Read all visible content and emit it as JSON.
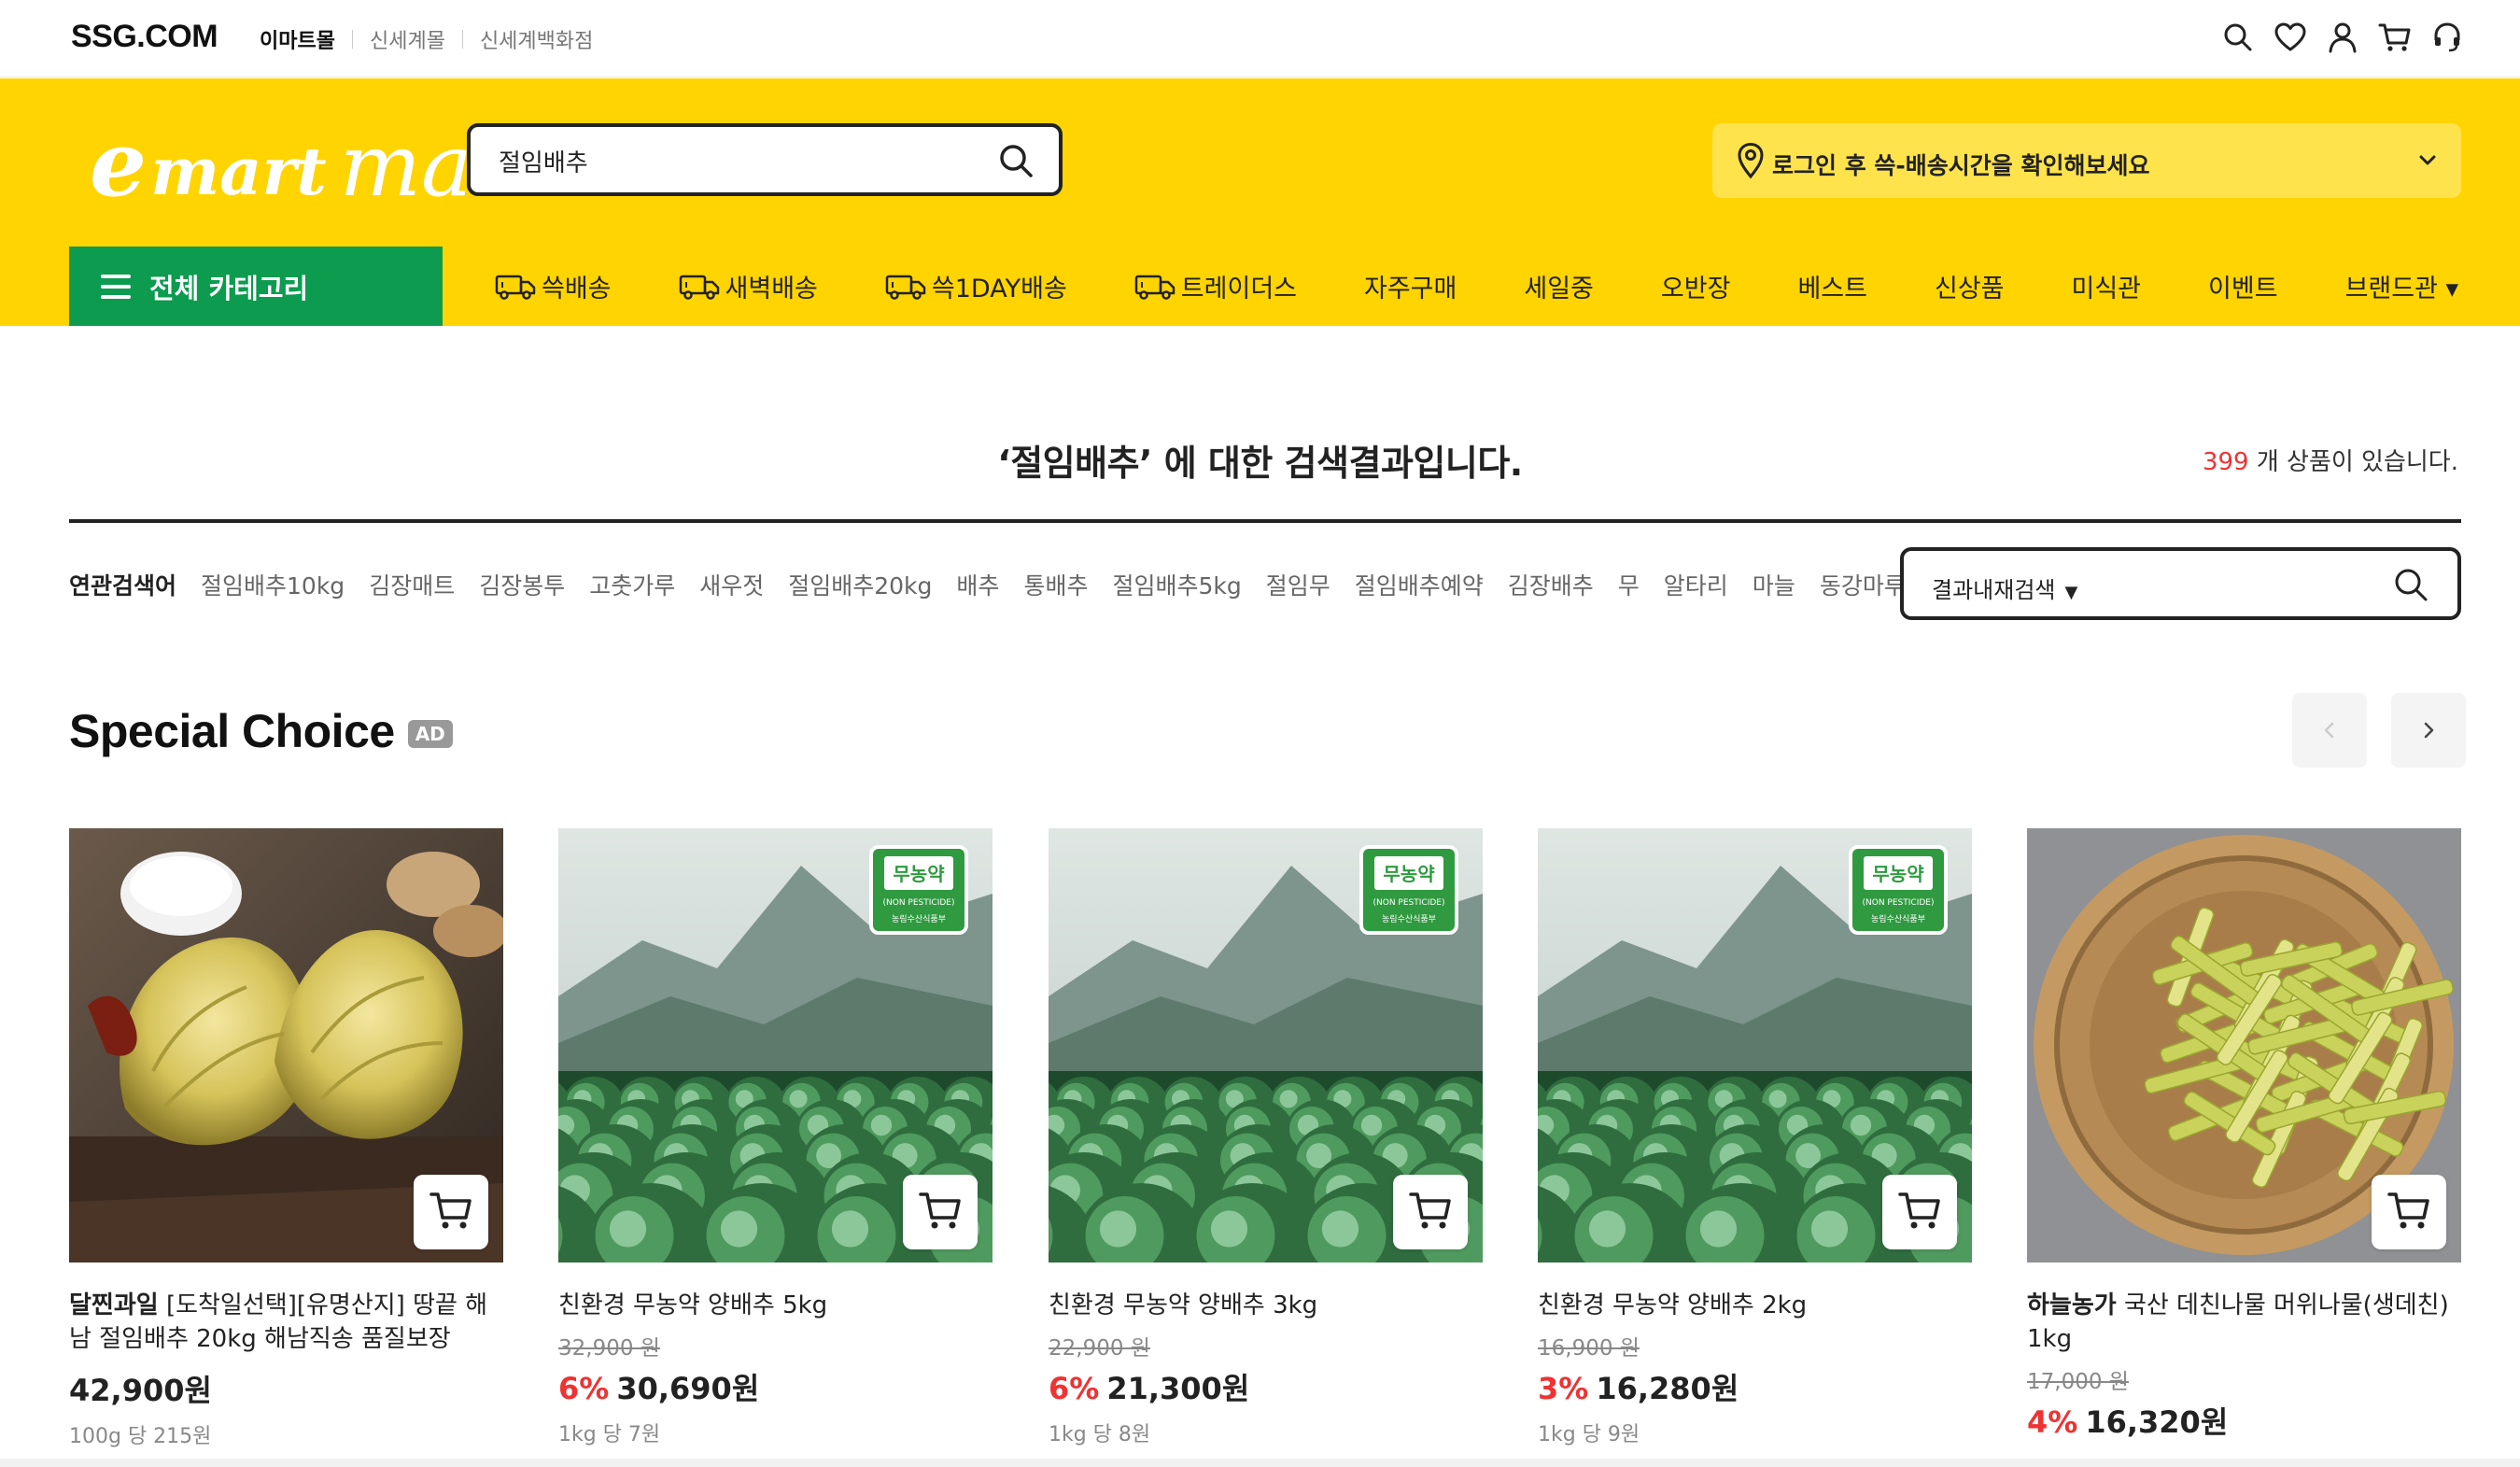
{
  "topbar": {
    "brand": "SSG.COM",
    "links": [
      {
        "label": "이마트몰",
        "active": true
      },
      {
        "label": "신세계몰",
        "active": false
      },
      {
        "label": "신세계백화점",
        "active": false
      }
    ],
    "icons": [
      "search-icon",
      "heart-icon",
      "user-icon",
      "cart-icon",
      "headset-icon"
    ]
  },
  "header": {
    "logo": {
      "e": "e",
      "mart": "mart",
      "mall": "mall"
    },
    "search": {
      "value": "절임배추"
    },
    "delivery": {
      "text": "로그인 후 쓱-배송시간을 확인해보세요"
    }
  },
  "nav": {
    "all_category": "전체 카테고리",
    "items": [
      {
        "label": "쓱배송",
        "truck": true
      },
      {
        "label": "새벽배송",
        "truck": true
      },
      {
        "label": "쓱1DAY배송",
        "truck": true
      },
      {
        "label": "트레이더스",
        "truck": true
      },
      {
        "label": "자주구매",
        "truck": false
      },
      {
        "label": "세일중",
        "truck": false
      },
      {
        "label": "오반장",
        "truck": false
      },
      {
        "label": "베스트",
        "truck": false
      },
      {
        "label": "신상품",
        "truck": false
      },
      {
        "label": "미식관",
        "truck": false
      },
      {
        "label": "이벤트",
        "truck": false
      },
      {
        "label": "브랜드관 ▾",
        "truck": false
      }
    ]
  },
  "results": {
    "title": "‘절임배추’ 에 대한 검색결과입니다.",
    "count": "399",
    "count_suffix": " 개 상품이 있습니다."
  },
  "related": {
    "label": "연관검색어",
    "keywords": [
      "절임배추10kg",
      "김장매트",
      "김장봉투",
      "고춧가루",
      "새우젓",
      "절임배추20kg",
      "배추",
      "통배추",
      "절임배추5kg",
      "절임무",
      "절임배추예약",
      "김장배추",
      "무",
      "알타리",
      "마늘",
      "동강마루"
    ],
    "in_search_label": "결과내재검색"
  },
  "special": {
    "title": "Special Choice",
    "ad_badge": "AD"
  },
  "products": [
    {
      "brand": "달찐과일",
      "name": " [도착일선택][유명산지] 땅끝 해남 절임배추 20kg 해남직송 품질보장",
      "original": "",
      "discount": "",
      "price": "42,900원",
      "unit": "100g 당 215원",
      "image": "kimchi-cabbage"
    },
    {
      "brand": "",
      "name": "친환경 무농약 양배추 5kg",
      "original": "32,900 원",
      "discount": "6%",
      "price": "30,690원",
      "unit": "1kg 당 7원",
      "image": "cabbage-field"
    },
    {
      "brand": "",
      "name": "친환경 무농약 양배추 3kg",
      "original": "22,900 원",
      "discount": "6%",
      "price": "21,300원",
      "unit": "1kg 당 8원",
      "image": "cabbage-field"
    },
    {
      "brand": "",
      "name": "친환경 무농약 양배추 2kg",
      "original": "16,900 원",
      "discount": "3%",
      "price": "16,280원",
      "unit": "1kg 당 9원",
      "image": "cabbage-field"
    },
    {
      "brand": "하늘농가",
      "name": " 국산 데친나물 머위나물(생데친) 1kg",
      "original": "17,000 원",
      "discount": "4%",
      "price": "16,320원",
      "unit": "",
      "image": "butterbur-basket"
    }
  ],
  "organic_badge": {
    "main": "무농약",
    "sub": "(NON PESTICIDE)",
    "cert": "농림수산식품부"
  },
  "colors": {
    "brand_yellow": "#ffd400",
    "category_green": "#0c9b4f",
    "discount_red": "#e33333"
  }
}
